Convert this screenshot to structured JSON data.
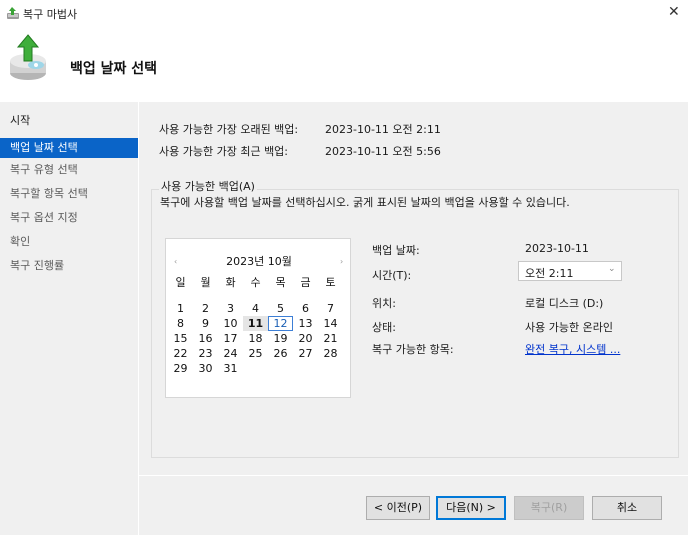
{
  "window": {
    "title": "복구 마법사",
    "close_glyph": "✕",
    "icon": "wizard-icon"
  },
  "header": {
    "heading": "백업 날짜 선택",
    "icon": "backup-restore-icon"
  },
  "sidebar": {
    "items": [
      {
        "label": "시작",
        "state": "normal"
      },
      {
        "label": "백업 날짜 선택",
        "state": "active"
      },
      {
        "label": "복구 유형 선택",
        "state": "normal"
      },
      {
        "label": "복구할 항목 선택",
        "state": "normal"
      },
      {
        "label": "복구 옵션 지정",
        "state": "normal"
      },
      {
        "label": "확인",
        "state": "normal"
      },
      {
        "label": "복구 진행률",
        "state": "normal"
      }
    ]
  },
  "info": {
    "oldest_label": "사용 가능한 가장 오래된 백업:",
    "oldest_value": "2023-10-11 오전 2:11",
    "newest_label": "사용 가능한 가장 최근 백업:",
    "newest_value": "2023-10-11 오전 5:56"
  },
  "group": {
    "title": "사용 가능한 백업(A)",
    "description": "복구에 사용할 백업 날짜를 선택하십시오. 굵게 표시된 날짜의 백업을 사용할 수 있습니다."
  },
  "calendar": {
    "month_label": "2023년 10월",
    "prev_glyph": "‹",
    "next_glyph": "›",
    "weekdays": [
      "일",
      "월",
      "화",
      "수",
      "목",
      "금",
      "토"
    ],
    "weeks": [
      [
        "1",
        "2",
        "3",
        "4",
        "5",
        "6",
        "7"
      ],
      [
        "8",
        "9",
        "10",
        "11",
        "12",
        "13",
        "14"
      ],
      [
        "15",
        "16",
        "17",
        "18",
        "19",
        "20",
        "21"
      ],
      [
        "22",
        "23",
        "24",
        "25",
        "26",
        "27",
        "28"
      ],
      [
        "29",
        "30",
        "31",
        "",
        "",
        "",
        ""
      ]
    ],
    "available_day": "11",
    "today_day": "12"
  },
  "details": {
    "backup_date_label": "백업 날짜:",
    "backup_date_value": "2023-10-11",
    "time_label": "시간(T):",
    "time_value": "오전 2:11",
    "location_label": "위치:",
    "location_value": "로컬 디스크 (D:)",
    "status_label": "상태:",
    "status_value": "사용 가능한 온라인",
    "items_label": "복구 가능한 항목:",
    "items_value": "완전 복구, 시스템 ..."
  },
  "buttons": {
    "back": "< 이전(P)",
    "next": "다음(N) >",
    "recover": "복구(R)",
    "cancel": "취소"
  },
  "colors": {
    "accent": "#0a64c8",
    "link": "#0033cc",
    "panel": "#f0f0f0"
  }
}
